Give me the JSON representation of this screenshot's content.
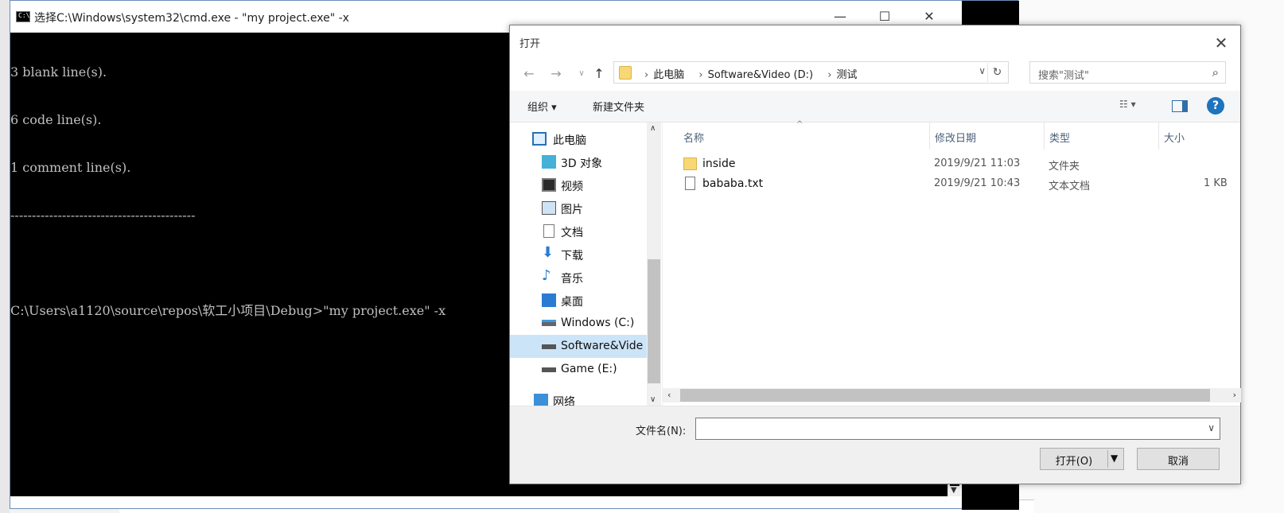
{
  "cmd": {
    "title": "选择C:\\Windows\\system32\\cmd.exe - \"my project.exe\"  -x",
    "icon": "cmd-icon",
    "buttons": {
      "minimize": "—",
      "maximize": "☐",
      "close": "✕"
    },
    "lines": [
      "3 blank line(s).",
      "6 code line(s).",
      "1 comment line(s).",
      "-------------------------------------------",
      "",
      "C:\\Users\\a1120\\source\\repos\\软工小项目\\Debug>\"my project.exe\" -x"
    ]
  },
  "dialog": {
    "title": "打开",
    "address": {
      "crumbs": [
        "此电脑",
        "Software&Video (D:)",
        "测试"
      ],
      "dropdown_icon": "chevron-down-icon",
      "refresh_icon": "refresh-icon"
    },
    "search_placeholder": "搜索\"测试\"",
    "toolbar": {
      "organize": "组织 ▾",
      "new_folder": "新建文件夹",
      "view_icon": "view-options-icon",
      "preview_pane_icon": "preview-pane-icon",
      "help": "?"
    },
    "nav_items": [
      {
        "label": "此电脑",
        "icon": "computer-icon"
      },
      {
        "label": "3D 对象",
        "icon": "3d-objects-icon"
      },
      {
        "label": "视频",
        "icon": "videos-icon"
      },
      {
        "label": "图片",
        "icon": "pictures-icon"
      },
      {
        "label": "文档",
        "icon": "documents-icon"
      },
      {
        "label": "下载",
        "icon": "downloads-icon"
      },
      {
        "label": "音乐",
        "icon": "music-icon"
      },
      {
        "label": "桌面",
        "icon": "desktop-icon"
      },
      {
        "label": "Windows (C:)",
        "icon": "drive-icon"
      },
      {
        "label": "Software&Vide",
        "icon": "drive-icon"
      },
      {
        "label": "Game (E:)",
        "icon": "drive-icon"
      },
      {
        "label": "网络",
        "icon": "network-icon"
      }
    ],
    "columns": [
      "名称",
      "修改日期",
      "类型",
      "大小"
    ],
    "files": [
      {
        "name": "inside",
        "date": "2019/9/21 11:03",
        "type": "文件夹",
        "size": "",
        "icon": "folder-icon"
      },
      {
        "name": "bababa.txt",
        "date": "2019/9/21 10:43",
        "type": "文本文档",
        "size": "1 KB",
        "icon": "text-file-icon"
      }
    ],
    "filename_label": "文件名(N):",
    "filename_value": "",
    "open_button": "打开(O)",
    "cancel_button": "取消",
    "close": "✕"
  },
  "colors": {
    "folder": "#f8d775",
    "selection": "#cce4f7",
    "accent": "#1e73be"
  }
}
